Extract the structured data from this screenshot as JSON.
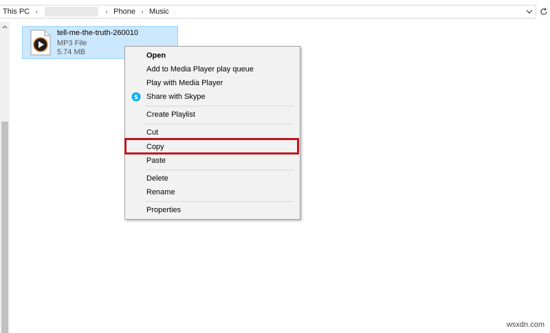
{
  "address_bar": {
    "crumbs": [
      "This PC",
      "Phone",
      "Music"
    ]
  },
  "file": {
    "name": "tell-me-the-truth-260010",
    "type": "MP3 File",
    "size": "5.74 MB"
  },
  "context_menu": {
    "items": [
      {
        "label": "Open"
      },
      {
        "label": "Add to Media Player play queue"
      },
      {
        "label": "Play with Media Player"
      },
      {
        "label": "Share with Skype"
      },
      {
        "label": "Create Playlist"
      },
      {
        "label": "Cut"
      },
      {
        "label": "Copy"
      },
      {
        "label": "Paste"
      },
      {
        "label": "Delete"
      },
      {
        "label": "Rename"
      },
      {
        "label": "Properties"
      }
    ]
  },
  "colors": {
    "selection_fill": "#cce8ff",
    "highlight_border": "#c0121d",
    "skype_blue": "#00aff0"
  },
  "watermark": "wsxdn.com"
}
